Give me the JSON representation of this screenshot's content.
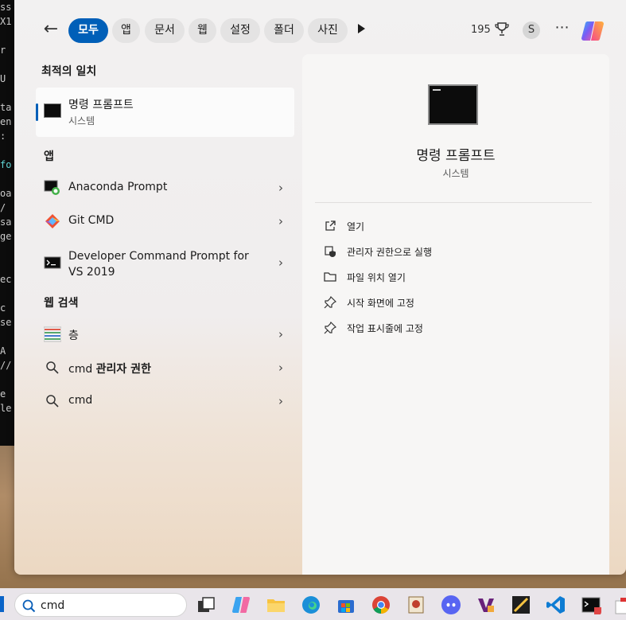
{
  "filters": {
    "tabs": [
      {
        "label": "모두",
        "active": true
      },
      {
        "label": "앱"
      },
      {
        "label": "문서"
      },
      {
        "label": "웹"
      },
      {
        "label": "설정"
      },
      {
        "label": "폴더"
      },
      {
        "label": "사진"
      }
    ],
    "points": "195",
    "avatar_initial": "S"
  },
  "best_match": {
    "section_title": "최적의 일치",
    "title": "명령 프롬프트",
    "subtitle": "시스템"
  },
  "apps": {
    "section_title": "앱",
    "items": [
      {
        "label": "Anaconda Prompt"
      },
      {
        "label": "Git CMD"
      },
      {
        "label": "Developer Command Prompt for VS 2019"
      }
    ]
  },
  "web": {
    "section_title": "웹 검색",
    "items": [
      {
        "label": "층"
      },
      {
        "prefix": "cmd ",
        "bold": "관리자 권한"
      },
      {
        "label": "cmd"
      }
    ]
  },
  "preview": {
    "title": "명령 프롬프트",
    "subtitle": "시스템",
    "actions": [
      {
        "label": "열기",
        "icon": "open-external-icon"
      },
      {
        "label": "관리자 권한으로 실행",
        "icon": "shield-icon"
      },
      {
        "label": "파일 위치 열기",
        "icon": "folder-icon"
      },
      {
        "label": "시작 화면에 고정",
        "icon": "pin-icon"
      },
      {
        "label": "작업 표시줄에 고정",
        "icon": "pin-icon"
      }
    ]
  },
  "taskbar": {
    "search_value": "cmd"
  },
  "colors": {
    "accent": "#005fb8"
  }
}
